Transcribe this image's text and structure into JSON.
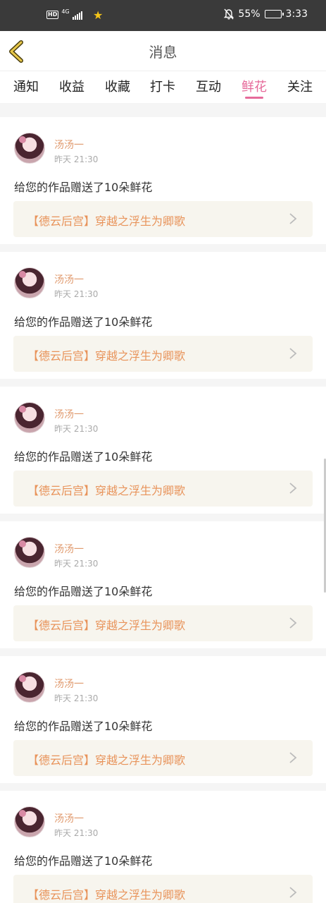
{
  "status_bar": {
    "hd": "HD",
    "network": "4G",
    "battery_percent": "55%",
    "battery_level": 0.55,
    "time": "3:33",
    "icons": [
      "hd-icon",
      "signal-icon",
      "star-icon",
      "mute-bell-icon",
      "battery-icon"
    ]
  },
  "header": {
    "title": "消息",
    "back_icon": "chevron-left-icon"
  },
  "tabs": [
    {
      "label": "通知",
      "active": false
    },
    {
      "label": "收益",
      "active": false
    },
    {
      "label": "收藏",
      "active": false
    },
    {
      "label": "打卡",
      "active": false
    },
    {
      "label": "互动",
      "active": false
    },
    {
      "label": "鲜花",
      "active": true
    },
    {
      "label": "关注",
      "active": false
    }
  ],
  "colors": {
    "accent": "#e66a9a",
    "username": "#e09a6e",
    "work_title": "#e8935a",
    "work_bg": "#f7f5ee"
  },
  "messages": [
    {
      "username": "汤汤一",
      "time": "昨天 21:30",
      "text": "给您的作品赠送了10朵鲜花",
      "work": "【德云后宫】穿越之浮生为卿歌"
    },
    {
      "username": "汤汤一",
      "time": "昨天 21:30",
      "text": "给您的作品赠送了10朵鲜花",
      "work": "【德云后宫】穿越之浮生为卿歌"
    },
    {
      "username": "汤汤一",
      "time": "昨天 21:30",
      "text": "给您的作品赠送了10朵鲜花",
      "work": "【德云后宫】穿越之浮生为卿歌"
    },
    {
      "username": "汤汤一",
      "time": "昨天 21:30",
      "text": "给您的作品赠送了10朵鲜花",
      "work": "【德云后宫】穿越之浮生为卿歌"
    },
    {
      "username": "汤汤一",
      "time": "昨天 21:30",
      "text": "给您的作品赠送了10朵鲜花",
      "work": "【德云后宫】穿越之浮生为卿歌"
    },
    {
      "username": "汤汤一",
      "time": "昨天 21:30",
      "text": "给您的作品赠送了10朵鲜花",
      "work": "【德云后宫】穿越之浮生为卿歌"
    }
  ]
}
